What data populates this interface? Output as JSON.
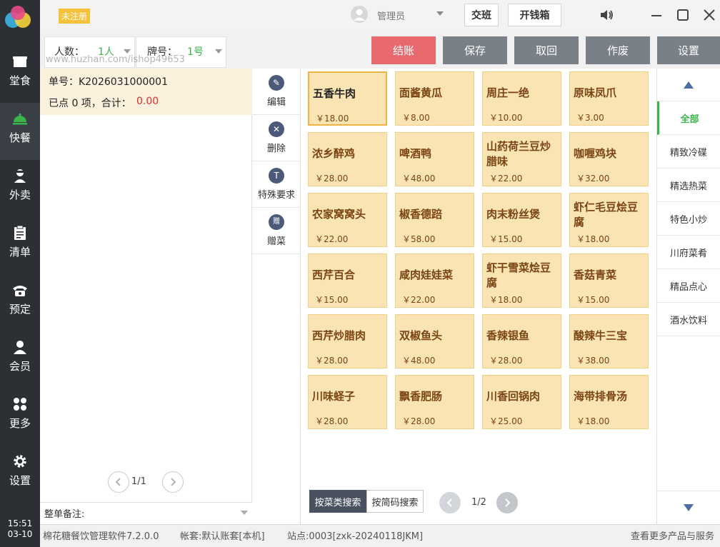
{
  "nav": {
    "items": [
      {
        "label": "堂食",
        "icon": "dine-in-icon"
      },
      {
        "label": "快餐",
        "icon": "service-bell-icon"
      },
      {
        "label": "外卖",
        "icon": "delivery-person-icon"
      },
      {
        "label": "清单",
        "icon": "clipboard-icon"
      },
      {
        "label": "预定",
        "icon": "phone-icon"
      },
      {
        "label": "会员",
        "icon": "member-icon"
      },
      {
        "label": "更多",
        "icon": "grid-icon"
      },
      {
        "label": "设置",
        "icon": "gear-icon"
      }
    ],
    "active_index": 1,
    "time": "15:51",
    "date": "03-10"
  },
  "header": {
    "unregistered_badge": "未注册",
    "user": "管理员",
    "handover_button": "交班",
    "cash_drawer_button": "开钱箱"
  },
  "controls": {
    "people_label": "人数：",
    "people_value": "1人",
    "tag_label": "牌号：",
    "tag_value": "1号",
    "watermark": "www.huzhan.com/ishop49653"
  },
  "actions": {
    "checkout": "结账",
    "save": "保存",
    "retrieve": "取回",
    "void": "作废",
    "settings": "设置"
  },
  "order": {
    "number_label": "单号：",
    "number": "K2026031000001",
    "summary": "已点 0 项，合计：",
    "total": "0.00",
    "page": "1/1",
    "remark_label": "整单备注:"
  },
  "item_actions": [
    {
      "label": "编辑",
      "icon": "edit-icon",
      "glyph": "✎"
    },
    {
      "label": "删除",
      "icon": "delete-icon",
      "glyph": "✕"
    },
    {
      "label": "特殊要求",
      "icon": "special-request-icon",
      "glyph": "T"
    },
    {
      "label": "赠菜",
      "icon": "gift-icon",
      "glyph": "赠"
    }
  ],
  "dishes": [
    {
      "name": "五香牛肉",
      "price": "￥18.00"
    },
    {
      "name": "面酱黄瓜",
      "price": "￥8.00"
    },
    {
      "name": "周庄一绝",
      "price": "￥10.00"
    },
    {
      "name": "原味凤爪",
      "price": "￥3.00"
    },
    {
      "name": "浓乡醉鸡",
      "price": "￥28.00"
    },
    {
      "name": "啤酒鸭",
      "price": "￥48.00"
    },
    {
      "name": "山药荷兰豆炒腊味",
      "price": "￥22.00"
    },
    {
      "name": "咖喱鸡块",
      "price": "￥32.00"
    },
    {
      "name": "农家窝窝头",
      "price": "￥22.00"
    },
    {
      "name": "椒香德踣",
      "price": "￥58.00"
    },
    {
      "name": "肉末粉丝煲",
      "price": "￥15.00"
    },
    {
      "name": "虾仁毛豆烩豆腐",
      "price": "￥18.00"
    },
    {
      "name": "西芹百合",
      "price": "￥15.00"
    },
    {
      "name": "咸肉娃娃菜",
      "price": "￥22.00"
    },
    {
      "name": "虾干雪菜烩豆腐",
      "price": "￥18.00"
    },
    {
      "name": "香菇青菜",
      "price": "￥15.00"
    },
    {
      "name": "西芹炒腊肉",
      "price": "￥28.00"
    },
    {
      "name": "双椒鱼头",
      "price": "￥48.00"
    },
    {
      "name": "香辣银鱼",
      "price": "￥28.00"
    },
    {
      "name": "酸辣牛三宝",
      "price": "￥38.00"
    },
    {
      "name": "川味蛏子",
      "price": "￥28.00"
    },
    {
      "name": "飘香肥肠",
      "price": "￥28.00"
    },
    {
      "name": "川香回锅肉",
      "price": "￥25.00"
    },
    {
      "name": "海带排骨汤",
      "price": "￥18.00"
    }
  ],
  "dish_search": {
    "by_category": "按菜类搜索",
    "by_code": "按简码搜索",
    "page": "1/2"
  },
  "categories": [
    "全部",
    "精致冷碟",
    "精选热菜",
    "特色小炒",
    "川府菜肴",
    "精品点心",
    "酒水饮料"
  ],
  "status_bar": {
    "software": "棉花糖餐饮管理软件7.2.0.0",
    "account": "帐套:默认账套[本机]",
    "station": "站点:0003[zxk-20240118JKM]",
    "more": "查看更多产品与服务"
  },
  "colors": {
    "nav_bg": "#2c3035",
    "accent_green": "#39b54a",
    "checkout_red": "#e96a6e",
    "action_gray": "#7a8088",
    "dish_bg": "#fbe4b3",
    "dish_text": "#7a4414",
    "total_red": "#e02a2a"
  }
}
